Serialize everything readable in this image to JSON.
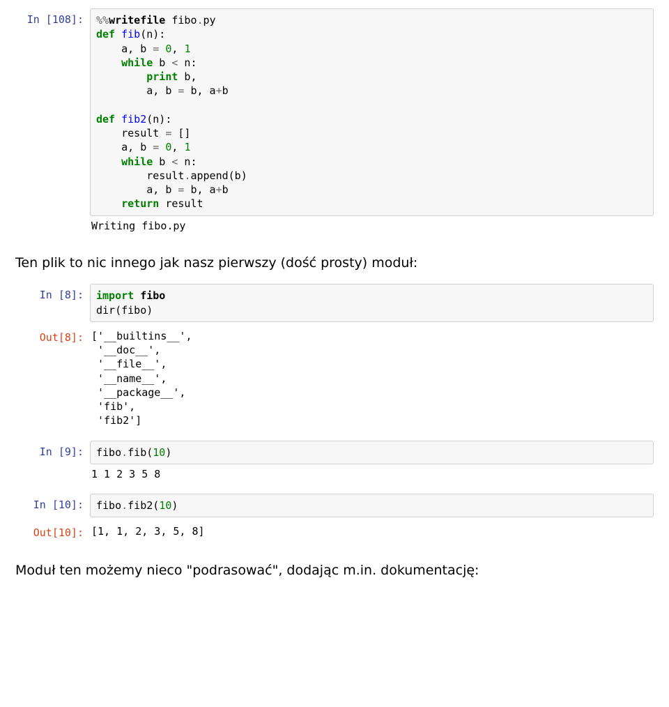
{
  "cells": {
    "c108": {
      "prompt": "In [108]:",
      "tokens": [
        {
          "t": "%%",
          "c": "tok-op"
        },
        {
          "t": "writefile",
          "c": "tok-magic"
        },
        {
          "t": " fibo",
          "c": ""
        },
        {
          "t": ".",
          "c": "tok-op"
        },
        {
          "t": "py",
          "c": ""
        },
        {
          "t": "\n",
          "c": ""
        },
        {
          "t": "def",
          "c": "tok-kw"
        },
        {
          "t": " ",
          "c": ""
        },
        {
          "t": "fib",
          "c": "tok-def"
        },
        {
          "t": "(n):",
          "c": ""
        },
        {
          "t": "\n",
          "c": ""
        },
        {
          "t": "    a, b ",
          "c": ""
        },
        {
          "t": "=",
          "c": "tok-op"
        },
        {
          "t": " ",
          "c": ""
        },
        {
          "t": "0",
          "c": "tok-num"
        },
        {
          "t": ", ",
          "c": ""
        },
        {
          "t": "1",
          "c": "tok-num"
        },
        {
          "t": "\n",
          "c": ""
        },
        {
          "t": "    ",
          "c": ""
        },
        {
          "t": "while",
          "c": "tok-kw"
        },
        {
          "t": " b ",
          "c": ""
        },
        {
          "t": "<",
          "c": "tok-op"
        },
        {
          "t": " n:",
          "c": ""
        },
        {
          "t": "\n",
          "c": ""
        },
        {
          "t": "        ",
          "c": ""
        },
        {
          "t": "print",
          "c": "tok-kw"
        },
        {
          "t": " b,",
          "c": ""
        },
        {
          "t": "\n",
          "c": ""
        },
        {
          "t": "        a, b ",
          "c": ""
        },
        {
          "t": "=",
          "c": "tok-op"
        },
        {
          "t": " b, a",
          "c": ""
        },
        {
          "t": "+",
          "c": "tok-op"
        },
        {
          "t": "b",
          "c": ""
        },
        {
          "t": "\n",
          "c": ""
        },
        {
          "t": "\n",
          "c": ""
        },
        {
          "t": "def",
          "c": "tok-kw"
        },
        {
          "t": " ",
          "c": ""
        },
        {
          "t": "fib2",
          "c": "tok-def"
        },
        {
          "t": "(n):",
          "c": ""
        },
        {
          "t": "\n",
          "c": ""
        },
        {
          "t": "    result ",
          "c": ""
        },
        {
          "t": "=",
          "c": "tok-op"
        },
        {
          "t": " []",
          "c": ""
        },
        {
          "t": "\n",
          "c": ""
        },
        {
          "t": "    a, b ",
          "c": ""
        },
        {
          "t": "=",
          "c": "tok-op"
        },
        {
          "t": " ",
          "c": ""
        },
        {
          "t": "0",
          "c": "tok-num"
        },
        {
          "t": ", ",
          "c": ""
        },
        {
          "t": "1",
          "c": "tok-num"
        },
        {
          "t": "\n",
          "c": ""
        },
        {
          "t": "    ",
          "c": ""
        },
        {
          "t": "while",
          "c": "tok-kw"
        },
        {
          "t": " b ",
          "c": ""
        },
        {
          "t": "<",
          "c": "tok-op"
        },
        {
          "t": " n:",
          "c": ""
        },
        {
          "t": "\n",
          "c": ""
        },
        {
          "t": "        result",
          "c": ""
        },
        {
          "t": ".",
          "c": "tok-op"
        },
        {
          "t": "append(b)",
          "c": ""
        },
        {
          "t": "\n",
          "c": ""
        },
        {
          "t": "        a, b ",
          "c": ""
        },
        {
          "t": "=",
          "c": "tok-op"
        },
        {
          "t": " b, a",
          "c": ""
        },
        {
          "t": "+",
          "c": "tok-op"
        },
        {
          "t": "b",
          "c": ""
        },
        {
          "t": "\n",
          "c": ""
        },
        {
          "t": "    ",
          "c": ""
        },
        {
          "t": "return",
          "c": "tok-kw"
        },
        {
          "t": " result",
          "c": ""
        }
      ],
      "stdout": "Writing fibo.py"
    },
    "narr1": "Ten plik to nic innego jak nasz pierwszy (dość prosty) moduł:",
    "c8": {
      "prompt": "In [8]:",
      "tokens": [
        {
          "t": "import",
          "c": "tok-kw"
        },
        {
          "t": " ",
          "c": ""
        },
        {
          "t": "fibo",
          "c": "tok-magic"
        },
        {
          "t": "\n",
          "c": ""
        },
        {
          "t": "dir",
          "c": ""
        },
        {
          "t": "(fibo)",
          "c": ""
        }
      ]
    },
    "out8": {
      "prompt": "Out[8]:",
      "text": "['__builtins__',\n '__doc__',\n '__file__',\n '__name__',\n '__package__',\n 'fib',\n 'fib2']"
    },
    "c9": {
      "prompt": "In [9]:",
      "tokens": [
        {
          "t": "fibo",
          "c": ""
        },
        {
          "t": ".",
          "c": "tok-op"
        },
        {
          "t": "fib(",
          "c": ""
        },
        {
          "t": "10",
          "c": "tok-num"
        },
        {
          "t": ")",
          "c": ""
        }
      ],
      "stdout": "1 1 2 3 5 8"
    },
    "c10": {
      "prompt": "In [10]:",
      "tokens": [
        {
          "t": "fibo",
          "c": ""
        },
        {
          "t": ".",
          "c": "tok-op"
        },
        {
          "t": "fib2(",
          "c": ""
        },
        {
          "t": "10",
          "c": "tok-num"
        },
        {
          "t": ")",
          "c": ""
        }
      ]
    },
    "out10": {
      "prompt": "Out[10]:",
      "text": "[1, 1, 2, 3, 5, 8]"
    },
    "narr2": "Moduł ten możemy nieco \"podrasować\", dodając m.in. dokumentację:"
  }
}
